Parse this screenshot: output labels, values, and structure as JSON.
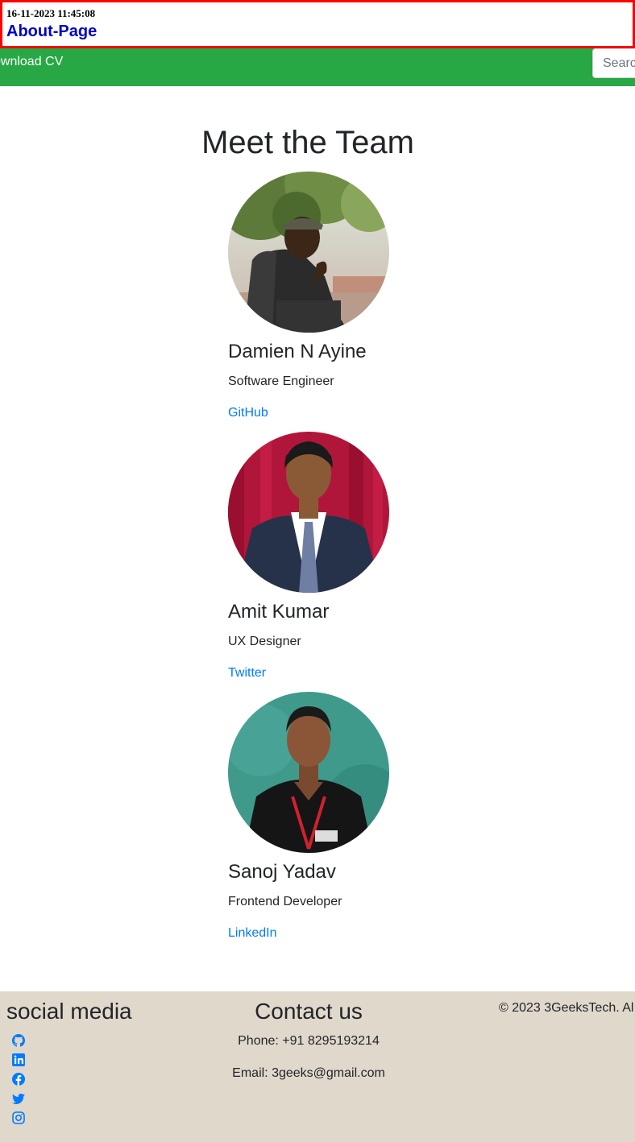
{
  "header": {
    "timestamp": "16-11-2023 11:45:08",
    "title": "About-Page"
  },
  "navbar": {
    "download_cv": "ownload CV",
    "search_placeholder": "Search",
    "bg_color": "#28a745"
  },
  "main": {
    "title": "Meet the Team",
    "members": [
      {
        "name": "Damien N Ayine",
        "role": "Software Engineer",
        "link": "GitHub"
      },
      {
        "name": "Amit Kumar",
        "role": "UX Designer",
        "link": "Twitter"
      },
      {
        "name": "Sanoj Yadav",
        "role": "Frontend Developer",
        "link": "LinkedIn"
      }
    ]
  },
  "footer": {
    "social_heading": "social media",
    "social_icons": [
      "github-icon",
      "linkedin-icon",
      "facebook-icon",
      "twitter-icon",
      "instagram-icon"
    ],
    "contact_heading": "Contact us",
    "phone": "Phone: +91 8295193214",
    "email": "Email: 3geeks@gmail.com",
    "copyright": "© 2023 3GeeksTech. Al",
    "bg_color": "#e0d8cb",
    "icon_color": "#007bff"
  }
}
